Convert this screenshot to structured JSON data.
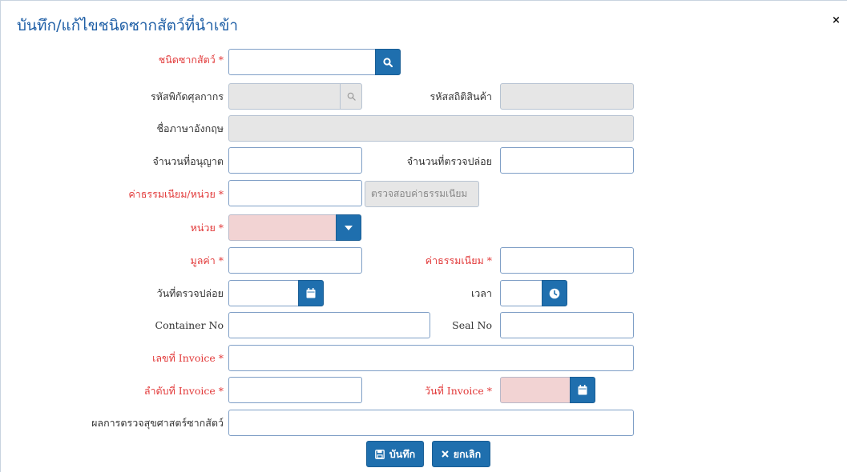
{
  "dialog": {
    "title": "บันทึก/แก้ไขชนิดซากสัตว์ที่นำเข้า",
    "close_glyph": "×"
  },
  "form": {
    "carcass_type_label": "ชนิดซากสัตว์ *",
    "carcass_type_value": "",
    "tariff_code_label": "รหัสพิกัดศุลกากร",
    "tariff_code_value": "",
    "stat_code_label": "รหัสสถิติสินค้า",
    "stat_code_value": "",
    "english_name_label": "ชื่อภาษาอังกฤษ",
    "english_name_value": "",
    "permitted_qty_label": "จำนวนที่อนุญาต",
    "permitted_qty_value": "",
    "released_qty_label": "จำนวนที่ตรวจปล่อย",
    "released_qty_value": "",
    "fee_per_unit_label": "ค่าธรรมเนียม/หน่วย *",
    "fee_per_unit_value": "",
    "check_fee_button": "ตรวจสอบค่าธรรมเนียม",
    "unit_label": "หน่วย *",
    "unit_value": "",
    "value_label": "มูลค่า *",
    "value_value": "",
    "fee_label": "ค่าธรรมเนียม *",
    "fee_value": "",
    "release_date_label": "วันที่ตรวจปล่อย",
    "release_date_value": "",
    "time_label": "เวลา",
    "time_value": "",
    "container_no_label": "Container No",
    "container_no_value": "",
    "seal_no_label": "Seal No",
    "seal_no_value": "",
    "invoice_no_label": "เลขที่ Invoice *",
    "invoice_no_value": "",
    "invoice_seq_label": "ลำดับที่ Invoice *",
    "invoice_seq_value": "",
    "invoice_date_label": "วันที่ Invoice *",
    "invoice_date_value": "",
    "vet_result_label": "ผลการตรวจสุขศาสตร์ซากสัตว์",
    "vet_result_value": ""
  },
  "actions": {
    "save_label": "บันทึก",
    "cancel_label": "ยกเลิก"
  },
  "colors": {
    "title": "#1f5fa6",
    "required_label": "#e23a3a",
    "primary_button": "#1f6fae",
    "disabled_field": "#e6e6e6",
    "pink_field": "#f2d3d3"
  },
  "icons": [
    "search-icon",
    "caret-down-icon",
    "calendar-icon",
    "clock-icon",
    "save-icon",
    "close-icon"
  ]
}
